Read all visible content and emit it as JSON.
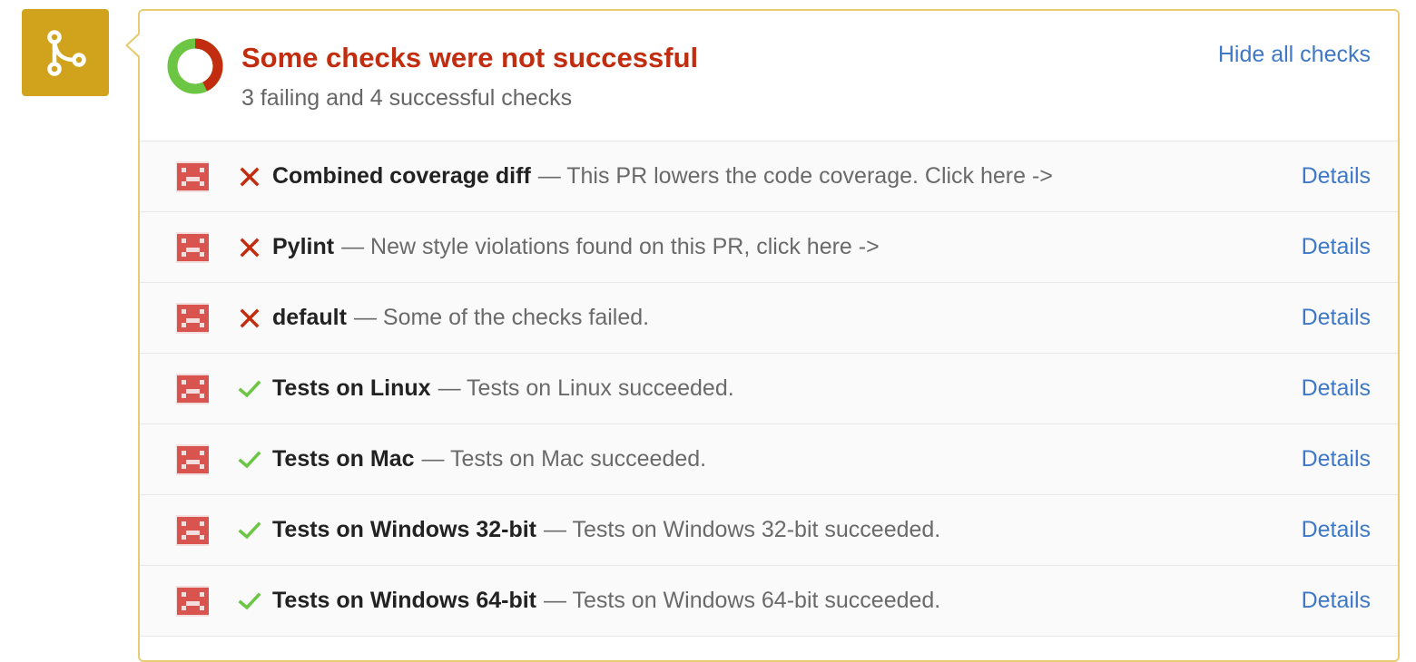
{
  "colors": {
    "badge": "#d1a31d",
    "panel_border": "#e8cc73",
    "failure": "#c22d0f",
    "success": "#6cc644",
    "link": "#3e78c7",
    "avatar": "#d9534f"
  },
  "summary": {
    "badge_icon": "merge-branch-icon",
    "title": "Some checks were not successful",
    "subtitle": "3 failing and 4 successful checks",
    "hide_link": "Hide all checks",
    "failing_count": 3,
    "successful_count": 4
  },
  "checks": [
    {
      "status": "failure",
      "name": "Combined coverage diff",
      "description": "— This PR lowers the code coverage. Click here ->",
      "link": "Details"
    },
    {
      "status": "failure",
      "name": "Pylint",
      "description": "— New style violations found on this PR, click here ->",
      "link": "Details"
    },
    {
      "status": "failure",
      "name": "default",
      "description": "— Some of the checks failed.",
      "link": "Details"
    },
    {
      "status": "success",
      "name": "Tests on Linux",
      "description": "— Tests on Linux succeeded.",
      "link": "Details"
    },
    {
      "status": "success",
      "name": "Tests on Mac",
      "description": "— Tests on Mac succeeded.",
      "link": "Details"
    },
    {
      "status": "success",
      "name": "Tests on Windows 32-bit",
      "description": "— Tests on Windows 32-bit succeeded.",
      "link": "Details"
    },
    {
      "status": "success",
      "name": "Tests on Windows 64-bit",
      "description": "— Tests on Windows 64-bit succeeded.",
      "link": "Details"
    }
  ]
}
